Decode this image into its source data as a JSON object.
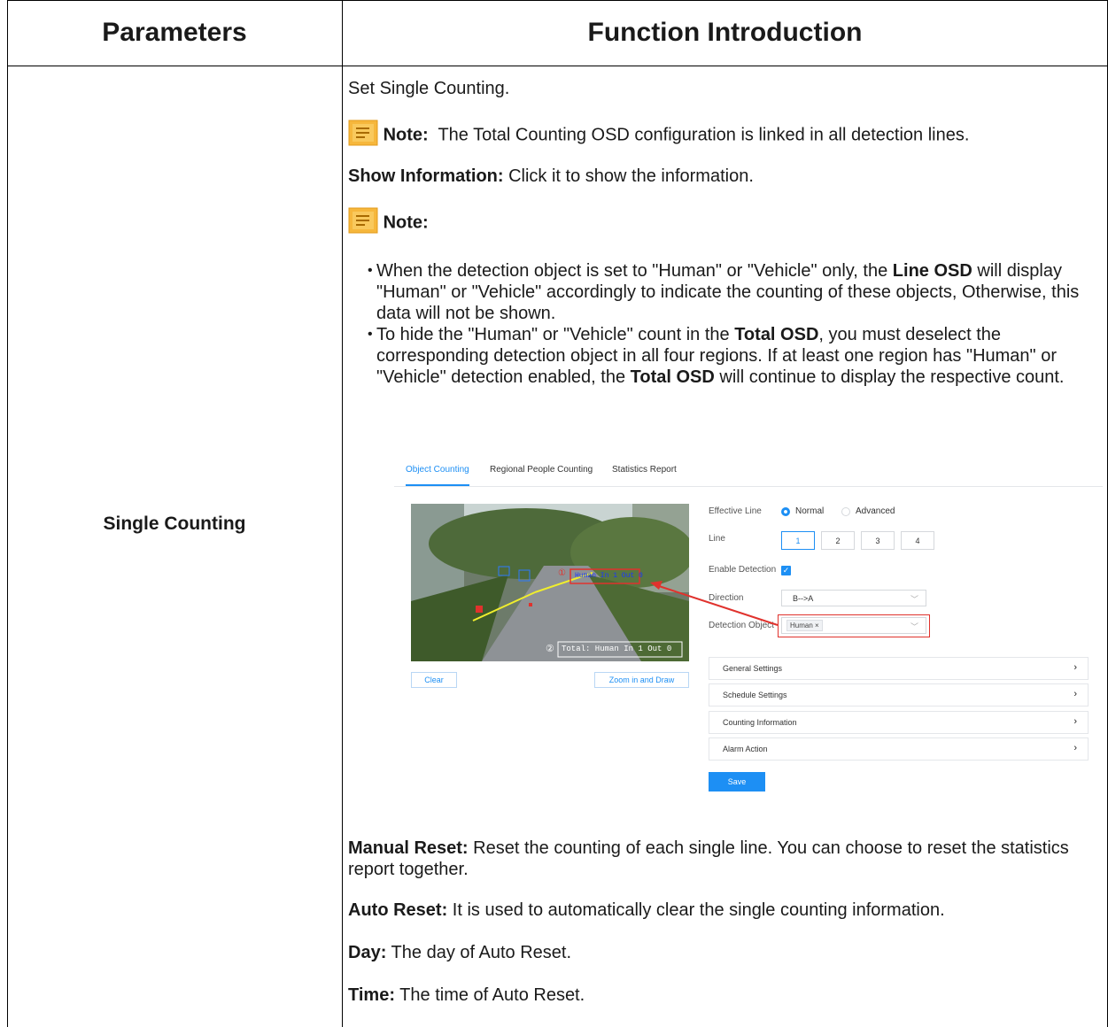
{
  "header": {
    "col1": "Parameters",
    "col2": "Function Introduction"
  },
  "param_name": "Single Counting",
  "content": {
    "intro": "Set Single Counting.",
    "note1_label": "Note:",
    "note1_text": "The Total Counting OSD configuration is linked in all detection lines.",
    "show_info_label": "Show Information:",
    "show_info_text": " Click it to show the information.",
    "note2_label": "Note:",
    "bullet1": {
      "a": "When the detection object is set to \"Human\" or \"Vehicle\" only, the ",
      "b": "Line OSD",
      "c": " will display \"Human\" or \"Vehicle\" accordingly to indicate the counting of these objects, Otherwise, this data will not be shown."
    },
    "bullet2": {
      "a": "To hide the \"Human\" or \"Vehicle\" count in the ",
      "b": "Total OSD",
      "c": ", you must deselect the corresponding detection object in all four regions. If at least one region has \"Human\" or \"Vehicle\" detection enabled, the ",
      "d": "Total OSD",
      "e": " will continue to display the respective count."
    },
    "manual_reset_label": "Manual Reset:",
    "manual_reset_text": " Reset the counting of each single line. You can choose to reset the statistics report together.",
    "auto_reset_label": "Auto Reset:",
    "auto_reset_text": " It is used to automatically clear the single counting information.",
    "day_label": "Day:",
    "day_text": " The day of Auto Reset.",
    "time_label": "Time:",
    "time_text": " The time of Auto Reset."
  },
  "screenshot": {
    "tabs": [
      "Object Counting",
      "Regional People Counting",
      "Statistics Report"
    ],
    "active_tab": "Object Counting",
    "clear_button": "Clear",
    "zoom_button": "Zoom in and Draw",
    "osd_line": "Human In 1 Out 0",
    "osd_total": "Total: Human In 1  Out 0",
    "osd_marker_1": "①",
    "osd_marker_2": "②",
    "effective_line_label": "Effective Line",
    "effective_options": [
      "Normal",
      "Advanced"
    ],
    "effective_selected": "Normal",
    "line_label": "Line",
    "line_buttons": [
      "1",
      "2",
      "3",
      "4"
    ],
    "line_selected": "1",
    "enable_detection_label": "Enable Detection",
    "enable_detection_checked": true,
    "direction_label": "Direction",
    "direction_value": "B-->A",
    "detection_object_label": "Detection Object",
    "detection_object_tag": "Human",
    "sections": [
      "General Settings",
      "Schedule Settings",
      "Counting Information",
      "Alarm Action"
    ],
    "save_button": "Save",
    "accent_color": "#1d8ff4",
    "highlight_color": "#e0322d"
  }
}
